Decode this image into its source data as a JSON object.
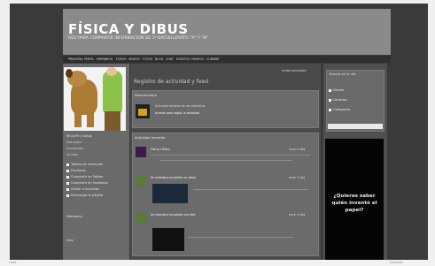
{
  "site": {
    "title": "FÍSICA Y DIBUS",
    "subtitle": "RED PARA COMPARTIR INFORMACIÓN DE 1º BACHILLERATO \"A\" Y \"B\""
  },
  "nav": [
    "PRINCIPAL",
    "PERFIL",
    "MIEMBROS",
    "FOROS",
    "VÍDEOS",
    "FOTOS",
    "BLOG",
    "CHAT",
    "EVENTOS",
    "GRUPOS",
    "CUMBRE"
  ],
  "main": {
    "title": "Registro de actividad y feed",
    "top_link": "Invitar amistades",
    "welcome_box": {
      "heading": "Bienvenido/a",
      "text": "Actividad reciente de los miembros",
      "link": "Accede para seguir la actividad"
    },
    "activity_header": "Actividad reciente",
    "items": [
      {
        "name": "Física y Dibus",
        "meta": "hace 2 días"
      },
      {
        "name": "Un miembro ha subido un vídeo",
        "meta": "hace 3 días"
      },
      {
        "name": "Un miembro ha subido una foto",
        "meta": "hace 4 días"
      }
    ]
  },
  "left": {
    "items": [
      "Mi perfil y datos",
      "Mensajes",
      "Amistades",
      "Ajustes"
    ],
    "links": [
      "Tarjeta de invitación",
      "Facebook",
      "Compartir en Twitter",
      "Compartir en Facebook",
      "Añadir a favoritos",
      "Descargar la página"
    ],
    "section": "Miembros",
    "section2": "Foro"
  },
  "right": {
    "heading": "Buscar en la red",
    "items": [
      "Diseño",
      "Usuarios",
      "Categorías"
    ],
    "ad_text": "¿Quieres saber quién inventó el papel?"
  },
  "status": {
    "left_text": "Listo",
    "right_text": "Internet"
  }
}
